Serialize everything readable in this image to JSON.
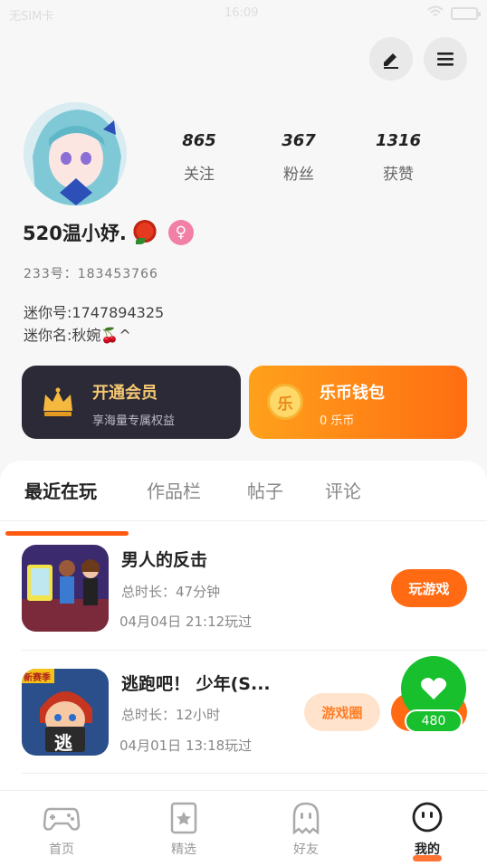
{
  "status_bar": {
    "carrier": "无SIM卡",
    "time": "16:09"
  },
  "top_actions": {
    "edit_icon": "pen-icon",
    "menu_icon": "menu-icon"
  },
  "profile": {
    "nickname": "520温小妤.",
    "id_line": "233号：183453766",
    "mini_id": "迷你号:1747894325",
    "mini_name": "迷你名:秋婉🍒^",
    "stats": [
      {
        "value": "865",
        "label": "关注"
      },
      {
        "value": "367",
        "label": "粉丝"
      },
      {
        "value": "1316",
        "label": "获赞"
      }
    ]
  },
  "cards": {
    "vip": {
      "title": "开通会员",
      "subtitle": "享海量专属权益"
    },
    "wallet": {
      "title": "乐币钱包",
      "subtitle": "0 乐币",
      "coin_char": "乐"
    }
  },
  "tabs": [
    "最近在玩",
    "作品栏",
    "帖子",
    "评论"
  ],
  "games": [
    {
      "name": "男人的反击",
      "duration": "总时长：47分钟",
      "last_played": "04月04日  21:12玩过",
      "button": "玩游戏"
    },
    {
      "name": "逃跑吧！ 少年(S...",
      "duration": "总时长：12小时",
      "last_played": "04月01日  13:18玩过",
      "button": "游戏圈",
      "badge": "新赛季",
      "thumb_label": "逃"
    }
  ],
  "likes_float": {
    "count": "480"
  },
  "bottom_nav": [
    {
      "label": "首页",
      "icon": "gamepad-icon"
    },
    {
      "label": "精选",
      "icon": "star-card-icon"
    },
    {
      "label": "好友",
      "icon": "ghost-icon"
    },
    {
      "label": "我的",
      "icon": "smiley-icon"
    }
  ],
  "colors": {
    "accent": "#ff6a12",
    "vip_bg": "#2b2a36",
    "green": "#17c02c"
  }
}
